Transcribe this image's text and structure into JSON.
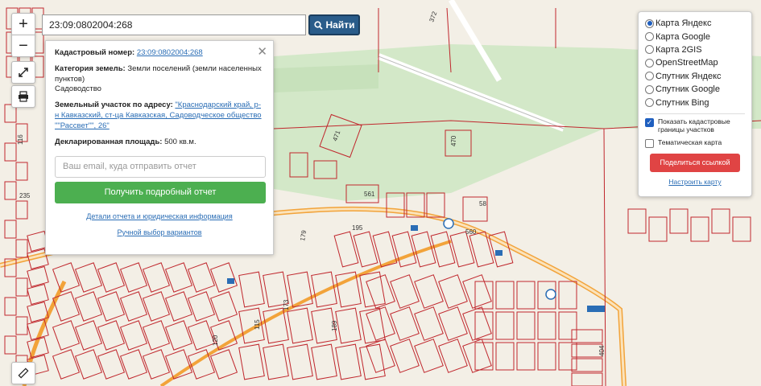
{
  "search": {
    "value": "23:09:0802004:268",
    "button_label": "Найти"
  },
  "controls": {
    "zoom_in": "+",
    "zoom_out": "−"
  },
  "info": {
    "cadastral_label": "Кадастровый номер:",
    "cadastral_value": "23:09:0802004:268",
    "category_label": "Категория земель:",
    "category_value": "Земли поселений (земли населенных пунктов)",
    "category_use": "Садоводство",
    "address_label": "Земельный участок по адресу:",
    "address_value": "\"Краснодарский край, р-н Кавказский, ст-ца Кавказская, Садоводческое общество \"\"Рассвет\"\", 26\"",
    "area_label": "Декларированная площадь:",
    "area_value": "500 кв.м.",
    "email_placeholder": "Ваш email, куда отправить отчет",
    "report_button": "Получить подробный отчет",
    "details_link": "Детали отчета и юридическая информация",
    "manual_link": "Ручной выбор вариантов"
  },
  "layers": {
    "options": [
      "Карта Яндекс",
      "Карта Google",
      "Карта 2GIS",
      "OpenStreetMap",
      "Спутник Яндекс",
      "Спутник Google",
      "Спутник Bing"
    ],
    "selected_index": 0,
    "show_boundaries_label": "Показать кадастровые границы участков",
    "show_boundaries_checked": true,
    "thematic_label": "Тематическая карта",
    "thematic_checked": false,
    "share_button": "Поделиться ссылкой",
    "config_link": "Настроить карту"
  },
  "map_labels": [
    "372",
    "471",
    "470",
    "561",
    "195",
    "179",
    "560",
    "58",
    "235",
    "116",
    "115",
    "173",
    "404",
    "189",
    "120"
  ],
  "colors": {
    "boundary": "#c0272d",
    "road": "#f2a33a",
    "green": "#cfe8c4",
    "accent_button": "#2a5c8a",
    "report_button": "#4caf50",
    "share_button": "#e04444"
  }
}
